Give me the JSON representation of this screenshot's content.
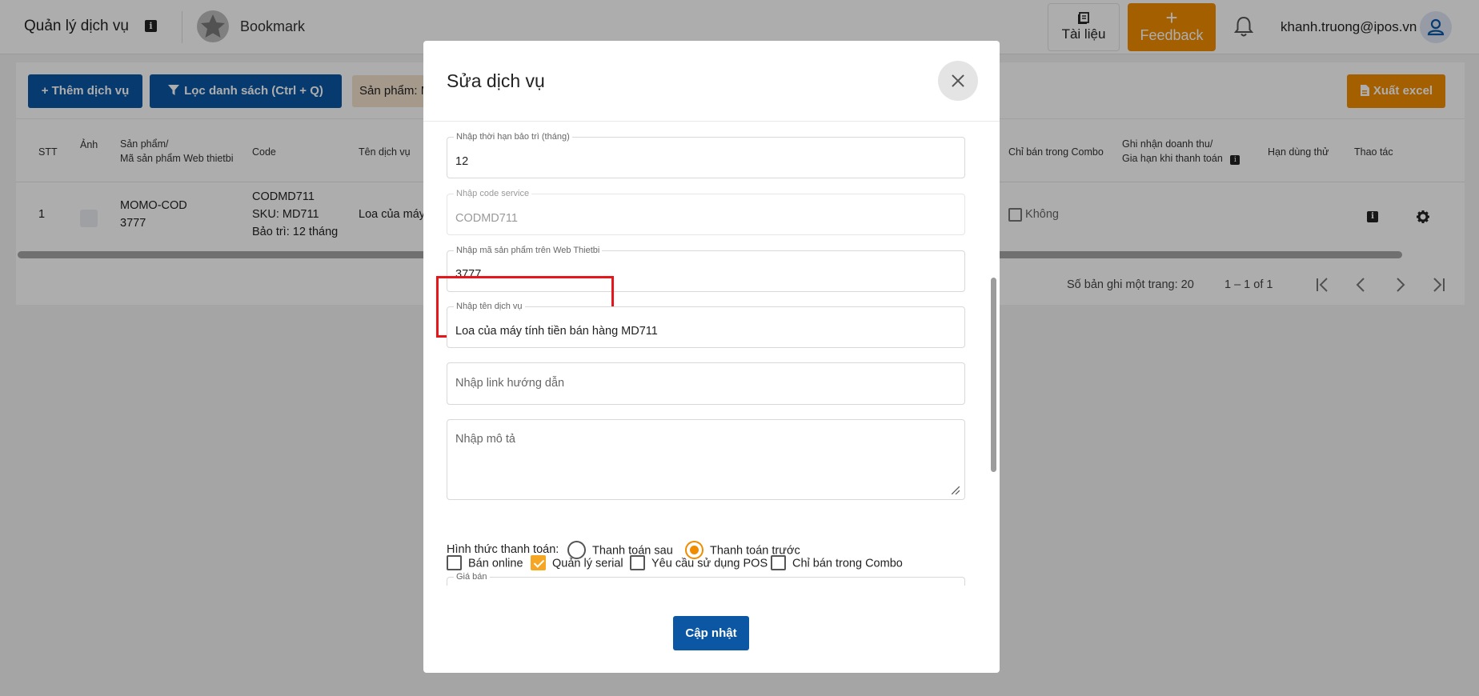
{
  "header": {
    "title": "Quản lý dịch vụ",
    "bookmark": "Bookmark",
    "docs_label": "Tài liệu",
    "feedback_plus": "+",
    "feedback_label": "Feedback",
    "user_email": "khanh.truong@ipos.vn"
  },
  "toolbar": {
    "add_label": "+ Thêm dịch vụ",
    "filter_label": "Lọc danh sách (Ctrl + Q)",
    "chip_label": "Sản phẩm: M",
    "export_label": "Xuất excel"
  },
  "table": {
    "headers": {
      "stt": "STT",
      "image": "Ảnh",
      "product_1": "Sản phẩm/",
      "product_2": "Mã sản phẩm Web thietbi",
      "code": "Code",
      "service_name": "Tên dịch vụ",
      "combo": "Chỉ bán trong Combo",
      "revenue_1": "Ghi nhận doanh thu/",
      "revenue_2": "Gia hạn khi thanh toán",
      "trial": "Hạn dùng thử",
      "actions": "Thao tác"
    },
    "rows": [
      {
        "stt": "1",
        "product_1": "MOMO-COD",
        "product_2": "3777",
        "code_1": "CODMD711",
        "code_2": "SKU: MD711",
        "code_3": "Bảo trì: 12 tháng",
        "service_name": "Loa của máy",
        "combo": "Không"
      }
    ],
    "pager": {
      "per_page": "Số bản ghi một trang: 20",
      "range": "1 – 1 of 1"
    }
  },
  "modal": {
    "title": "Sửa dịch vụ",
    "fields": {
      "maintenance_label": "Nhập thời hạn bảo trì (tháng)",
      "maintenance_value": "12",
      "code_label": "Nhập code service",
      "code_value": "CODMD711",
      "web_code_label": "Nhập mã sản phẩm trên Web Thietbi",
      "web_code_value": "3777",
      "name_label": "Nhập tên dịch vụ",
      "name_value": "Loa của máy tính tiền bán hàng MD711",
      "link_placeholder": "Nhập link hướng dẫn",
      "desc_placeholder": "Nhập mô tả",
      "price_label": "Giá bán"
    },
    "options": {
      "online": "Bán online",
      "serial": "Quản lý serial",
      "pos": "Yêu cầu sử dụng POS",
      "combo": "Chỉ bán trong Combo"
    },
    "payment": {
      "label": "Hình thức thanh toán:",
      "after": "Thanh toán sau",
      "before": "Thanh toán trước"
    },
    "submit_label": "Cập nhật"
  }
}
